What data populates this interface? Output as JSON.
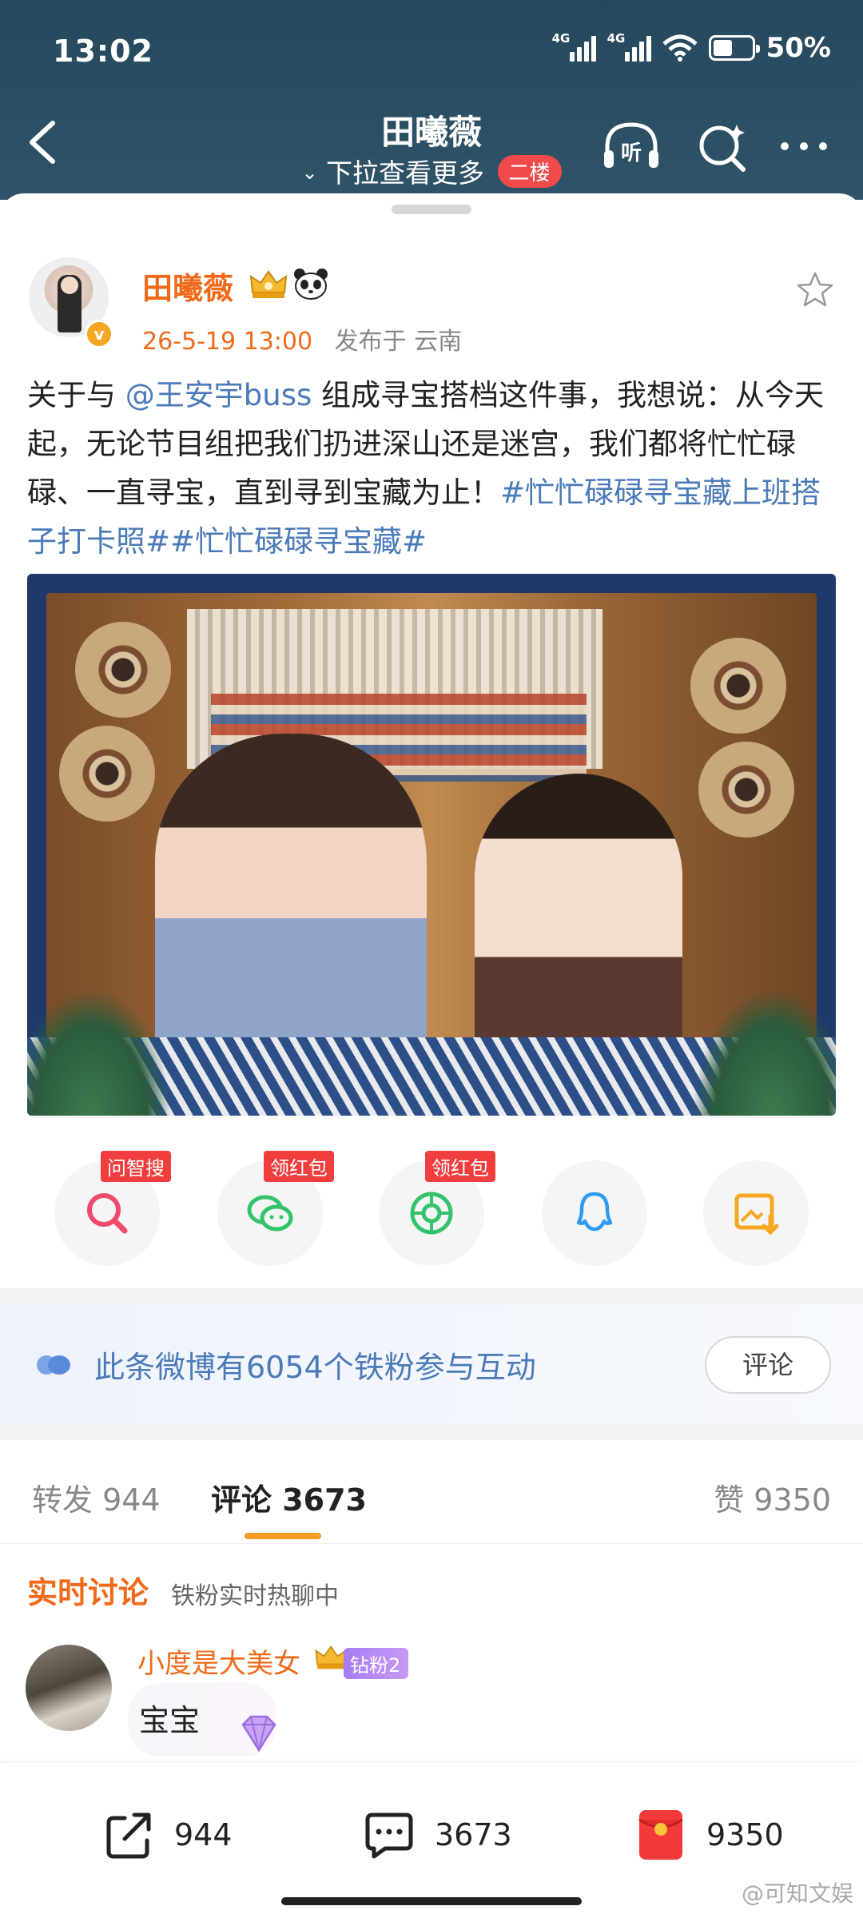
{
  "status_bar": {
    "time": "13:02",
    "signal1": "4G",
    "signal2": "4G",
    "battery_pct_text": "50%",
    "battery_level": 0.5
  },
  "nav": {
    "title": "田曦薇",
    "subtitle": "下拉查看更多",
    "badge": "二楼"
  },
  "post": {
    "author": "田曦薇",
    "time": "26-5-19 13:00",
    "location": "发布于 云南",
    "text_1": "关于与 ",
    "mention": "@王安宇buss",
    "text_2": " 组成寻宝搭档这件事，我想说：从今天起，无论节目组把我们扔进深山还是迷宫，我们都将忙忙碌碌、一直寻宝，直到寻到宝藏为止！",
    "tags": "#忙忙碌碌寻宝藏上班搭子打卡照##忙忙碌碌寻宝藏#"
  },
  "share_row": [
    {
      "name": "ask-search",
      "tag": "问智搜",
      "color": "#f04a6a"
    },
    {
      "name": "wechat",
      "tag": "领红包",
      "color": "#34c26b"
    },
    {
      "name": "moments",
      "tag": "领红包",
      "color": "#34c26b"
    },
    {
      "name": "qq",
      "tag": "",
      "color": "#2f9bf0"
    },
    {
      "name": "save-image",
      "tag": "",
      "color": "#f5a623"
    }
  ],
  "fans_banner": {
    "text": "此条微博有6054个铁粉参与互动",
    "button": "评论"
  },
  "tabs": {
    "repost": "转发 944",
    "comment": "评论 3673",
    "like": "赞 9350"
  },
  "realtime": {
    "title": "实时讨论",
    "subtitle": "铁粉实时热聊中"
  },
  "comment": {
    "name": "小度是大美女",
    "badge": "钻粉2",
    "text": "宝宝"
  },
  "bottom_bar": {
    "repost_count": "944",
    "comment_count": "3673",
    "like_count": "9350"
  },
  "watermark": "@可知文娱"
}
